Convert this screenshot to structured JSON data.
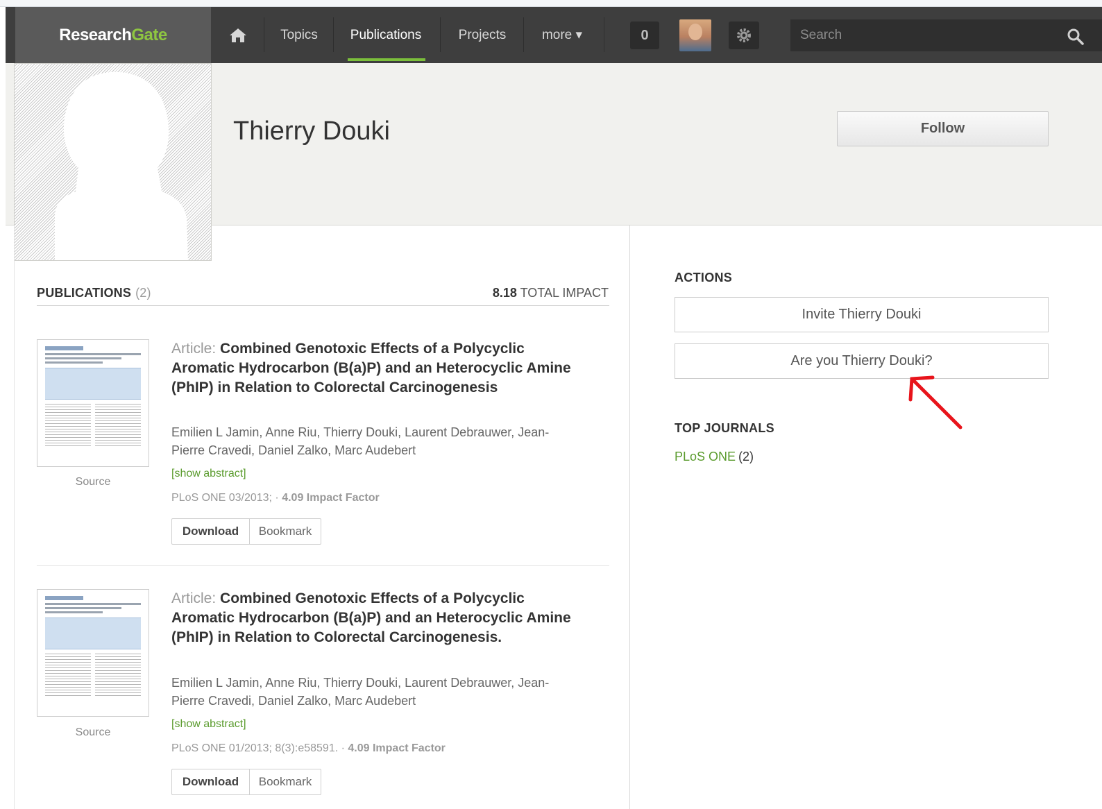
{
  "nav": {
    "logo_research": "Research",
    "logo_gate": "Gate",
    "items": [
      "Topics",
      "Publications",
      "Projects",
      "more ▾"
    ],
    "active_item": "Publications",
    "notifications": "0",
    "search_placeholder": "Search"
  },
  "profile": {
    "name": "Thierry Douki",
    "follow_label": "Follow"
  },
  "publications": {
    "section_title": "PUBLICATIONS",
    "count": "(2)",
    "total_impact_value": "8.18",
    "total_impact_label": "TOTAL IMPACT",
    "items": [
      {
        "type": "Article:",
        "title": "Combined Genotoxic Effects of a Polycyclic Aromatic Hydrocarbon (B(a)P) and an Heterocyclic Amine (PhIP) in Relation to Colorectal Carcinogenesis",
        "authors": "Emilien L Jamin, Anne Riu, Thierry Douki, Laurent Debrauwer, Jean-Pierre Cravedi, Daniel Zalko, Marc Audebert",
        "show_abstract": "[show abstract]",
        "journal_info": "PLoS ONE 03/2013;",
        "impact": "4.09 Impact Factor",
        "source": "Source",
        "download": "Download",
        "bookmark": "Bookmark"
      },
      {
        "type": "Article:",
        "title": "Combined Genotoxic Effects of a Polycyclic Aromatic Hydrocarbon (B(a)P) and an Heterocyclic Amine (PhIP) in Relation to Colorectal Carcinogenesis.",
        "authors": "Emilien L Jamin, Anne Riu, Thierry Douki, Laurent Debrauwer, Jean-Pierre Cravedi, Daniel Zalko, Marc Audebert",
        "show_abstract": "[show abstract]",
        "journal_info": "PLoS ONE 01/2013; 8(3):e58591.",
        "impact": "4.09 Impact Factor",
        "source": "Source",
        "download": "Download",
        "bookmark": "Bookmark"
      }
    ]
  },
  "actions": {
    "title": "ACTIONS",
    "invite": "Invite Thierry Douki",
    "claim": "Are you Thierry Douki?"
  },
  "top_journals": {
    "title": "TOP JOURNALS",
    "items": [
      {
        "name": "PLoS ONE",
        "count": "(2)"
      }
    ]
  },
  "colors": {
    "nav_bg": "#3e3e3e",
    "accent_green": "#7bbf3b",
    "link_green": "#5a9b2d",
    "arrow_red": "#e8141b"
  }
}
